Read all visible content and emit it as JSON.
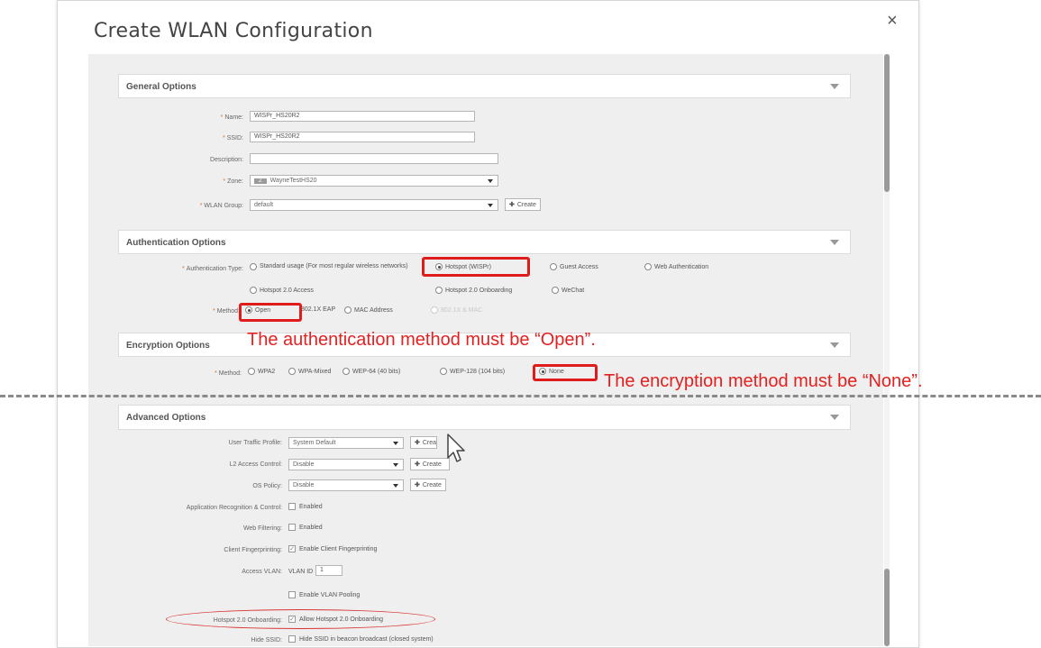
{
  "dialog": {
    "title": "Create WLAN Configuration",
    "close": "×"
  },
  "general": {
    "section_label": "General Options",
    "name_label": "Name:",
    "name_value": "WISPr_HS20R2",
    "ssid_label": "SSID:",
    "ssid_value": "WISPr_HS20R2",
    "description_label": "Description:",
    "description_value": "",
    "zone_label": "Zone:",
    "zone_badge": "Z",
    "zone_value": "WayneTestHS20",
    "wlan_group_label": "WLAN Group:",
    "wlan_group_value": "default",
    "create_label": "Create"
  },
  "auth": {
    "section_label": "Authentication Options",
    "type_label": "Authentication Type:",
    "options": {
      "standard": "Standard usage (For most regular wireless networks)",
      "hotspot": "Hotspot (WISPr)",
      "guest": "Guest Access",
      "web": "Web Authentication",
      "hs20_access": "Hotspot 2.0 Access",
      "hs20_onboarding": "Hotspot 2.0 Onboarding",
      "wechat": "WeChat"
    },
    "method_label": "Method:",
    "methods": {
      "open": "Open",
      "eap": "802.1X EAP",
      "mac": "MAC Address",
      "both": "802.1X & MAC"
    }
  },
  "encryption": {
    "section_label": "Encryption Options",
    "method_label": "Method:",
    "methods": {
      "wpa2": "WPA2",
      "wpa_mixed": "WPA-Mixed",
      "wep64": "WEP-64 (40 bits)",
      "wep128": "WEP-128 (104 bits)",
      "none": "None"
    }
  },
  "advanced": {
    "section_label": "Advanced Options",
    "user_traffic_label": "User Traffic Profile:",
    "user_traffic_value": "System Default",
    "l2_label": "L2 Access Control:",
    "l2_value": "Disable",
    "os_label": "OS Policy:",
    "os_value": "Disable",
    "create_label": "Create",
    "app_label": "Application Recognition & Control:",
    "app_value": "Enabled",
    "web_filter_label": "Web Filtering:",
    "web_filter_value": "Enabled",
    "client_fp_label": "Client Fingerprinting:",
    "client_fp_value": "Enable Client Fingerprinting",
    "vlan_label": "Access VLAN:",
    "vlan_id_label": "VLAN ID",
    "vlan_id_value": "1",
    "vlan_pooling": "Enable VLAN Pooling",
    "hs20_onboard_label": "Hotspot 2.0 Onboarding:",
    "hs20_onboard_value": "Allow Hotspot 2.0 Onboarding",
    "hide_ssid_label": "Hide SSID:",
    "hide_ssid_value": "Hide SSID in beacon broadcast (closed system)"
  },
  "annotations": {
    "auth_note": "The authentication method must be “Open”.",
    "enc_note": "The encryption method must be “None”."
  },
  "colors": {
    "highlight": "#e01b1b",
    "required": "#e0712b"
  }
}
